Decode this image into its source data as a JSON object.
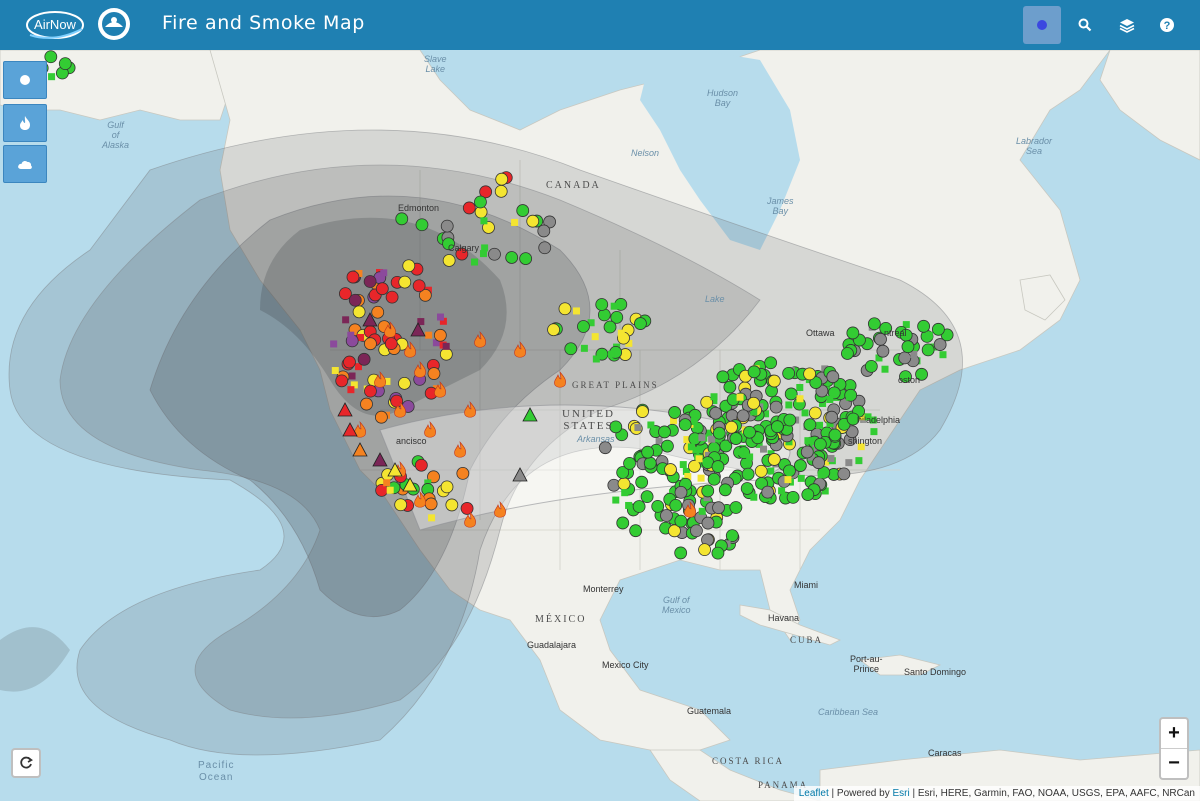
{
  "header": {
    "logo_text": "AirNow",
    "title": "Fire and Smoke Map",
    "buttons": [
      {
        "name": "monitors-toggle",
        "icon": "dot-icon",
        "active": true
      },
      {
        "name": "search",
        "icon": "search-icon"
      },
      {
        "name": "layers",
        "icon": "layers-icon"
      },
      {
        "name": "help",
        "icon": "help-icon"
      }
    ]
  },
  "sidebar": {
    "buttons": [
      {
        "name": "monitors-layer",
        "icon": "circle-icon"
      },
      {
        "name": "fires-layer",
        "icon": "flame-icon"
      },
      {
        "name": "smoke-layer",
        "icon": "cloud-icon"
      }
    ]
  },
  "map_labels": {
    "slave_lake": "Slave\nLake",
    "hudson_bay": "Hudson\nBay",
    "gulf_alaska": "Gulf\nof\nAlaska",
    "labrador_sea": "Labrador\nSea",
    "nelson": "Nelson",
    "james_bay": "James\nBay",
    "canada": "CANADA",
    "edmonton": "Edmonton",
    "calgary": "Calgary",
    "lake": "Lake",
    "ottawa": "Ottawa",
    "montreal": "ntreal",
    "boston": "oston",
    "great_plains": "GREAT PLAINS",
    "united_states": "UNITED\nSTATES",
    "philadelphia": "hiladelphia",
    "washington": "shington",
    "arkansas": "Arkansas",
    "francisco": "ancisco",
    "monterrey": "Monterrey",
    "gulf_mexico": "Gulf of\nMexico",
    "miami": "Miami",
    "mexico": "MÉXICO",
    "havana": "Havana",
    "cuba": "CUBA",
    "guadalajara": "Guadalajara",
    "mexico_city": "Mexico City",
    "port_au_prince": "Port-au-\nPrince",
    "santo_domingo": "Santo Domingo",
    "caribbean_sea": "Caribbean Sea",
    "guatemala": "Guatemala",
    "costa_rica": "COSTA RICA",
    "caracas": "Caracas",
    "pacific_ocean": "Pacific\nOcean",
    "panama": "PANAMA"
  },
  "attribution": {
    "leaflet": "Leaflet",
    "sep": " | Powered by ",
    "esri": "Esri",
    "rest": " | Esri, HERE, Garmin, FAO, NOAA, USGS, EPA, AAFC, NRCan"
  },
  "zoom": {
    "in": "+",
    "out": "−"
  },
  "colors": {
    "header": "#1f80b2",
    "good": "#33cc33",
    "moderate": "#f4e531",
    "usg": "#f58220",
    "unhealthy": "#e8262a",
    "very_unhealthy": "#7b2657",
    "hazardous": "#8b4a9c",
    "no_data": "#8a8a8a"
  }
}
